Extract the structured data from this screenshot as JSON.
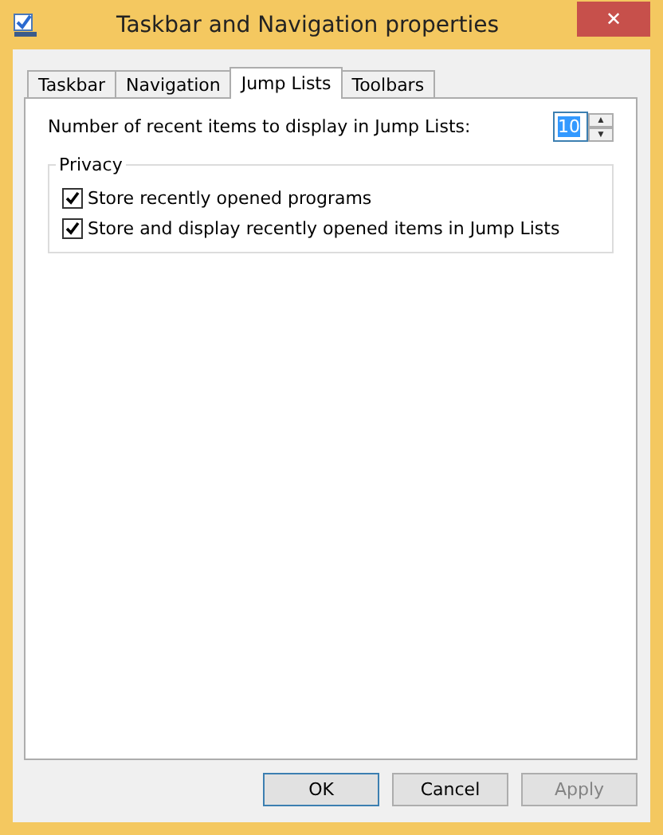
{
  "window": {
    "title": "Taskbar and Navigation properties",
    "close": "✕"
  },
  "tabs": [
    {
      "label": "Taskbar",
      "selected": false
    },
    {
      "label": "Navigation",
      "selected": false
    },
    {
      "label": "Jump Lists",
      "selected": true
    },
    {
      "label": "Toolbars",
      "selected": false
    }
  ],
  "recent_items": {
    "label": "Number of recent items to display in Jump Lists:",
    "value": "10",
    "up": "▲",
    "down": "▼"
  },
  "privacy": {
    "title": "Privacy",
    "options": [
      {
        "label": "Store recently opened programs",
        "checked": true
      },
      {
        "label": "Store and display recently opened items in Jump Lists",
        "checked": true
      }
    ]
  },
  "buttons": [
    {
      "label": "OK",
      "disabled": false,
      "default": true
    },
    {
      "label": "Cancel",
      "disabled": false,
      "default": false
    },
    {
      "label": "Apply",
      "disabled": true,
      "default": false
    }
  ]
}
